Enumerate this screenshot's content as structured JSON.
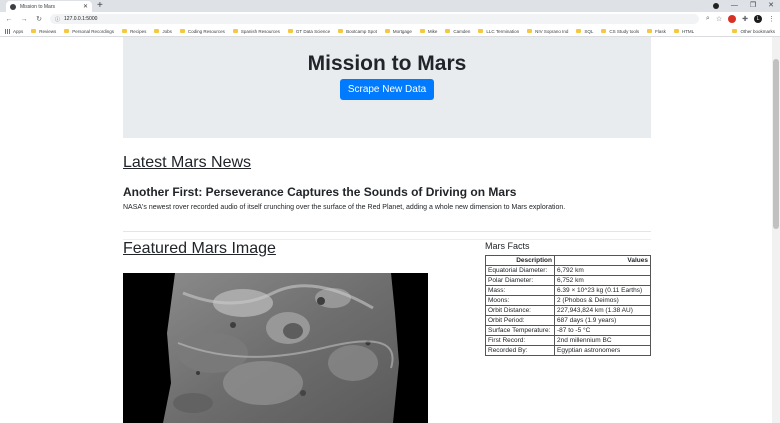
{
  "browser": {
    "tab_title": "Mission to Mars",
    "url": "127.0.0.1:5000",
    "profile_initial": "L",
    "bookmarks": [
      "Apps",
      "Reviews",
      "Personal Recordings",
      "Recipes",
      "Jobs",
      "Coding Resources",
      "Spanish Resources",
      "GT Data Science",
      "Bootcamp Spot",
      "Mortgage",
      "Mike",
      "Camden",
      "LLC Termination",
      "NIV Soprano Ind",
      "SQL",
      "CS Study tools",
      "Flask",
      "HTML"
    ],
    "other_bookmarks": "Other bookmarks"
  },
  "jumbotron": {
    "title": "Mission to Mars",
    "button_label": "Scrape New Data"
  },
  "news": {
    "heading": "Latest Mars News",
    "title": "Another First: Perseverance Captures the Sounds of Driving on Mars",
    "paragraph": "NASA's newest rover recorded audio of itself crunching over the surface of the Red Planet, adding a whole new dimension to Mars exploration."
  },
  "featured": {
    "heading": "Featured Mars Image"
  },
  "facts": {
    "title": "Mars Facts",
    "headers": [
      "Description",
      "Values"
    ],
    "rows": [
      [
        "Equatorial Diameter:",
        "6,792 km"
      ],
      [
        "Polar Diameter:",
        "6,752 km"
      ],
      [
        "Mass:",
        "6.39 × 10^23 kg (0.11 Earths)"
      ],
      [
        "Moons:",
        "2 (Phobos & Deimos)"
      ],
      [
        "Orbit Distance:",
        "227,943,824 km (1.38 AU)"
      ],
      [
        "Orbit Period:",
        "687 days (1.9 years)"
      ],
      [
        "Surface Temperature:",
        "-87 to -5 °C"
      ],
      [
        "First Record:",
        "2nd millennium BC"
      ],
      [
        "Recorded By:",
        "Egyptian astronomers"
      ]
    ]
  },
  "colors": {
    "button": "#007bff",
    "jumbotron_bg": "#e9ecef"
  }
}
